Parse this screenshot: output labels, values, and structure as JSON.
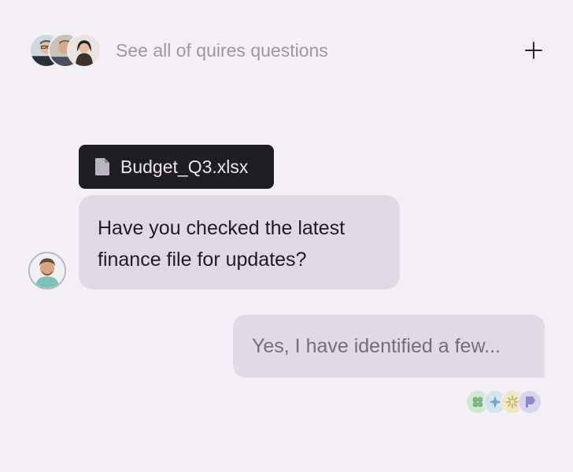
{
  "header": {
    "link_label": "See all of quires questions",
    "avatars": [
      "participant-1",
      "participant-2",
      "participant-3"
    ]
  },
  "attachment": {
    "file_name": "Budget_Q3.xlsx",
    "icon": "file-icon"
  },
  "messages": [
    {
      "direction": "incoming",
      "text": "Have you checked the latest finance file for updates?"
    },
    {
      "direction": "outgoing",
      "text": "Yes, I have identified a few..."
    }
  ],
  "reactors": [
    {
      "icon": "clover-icon",
      "color": "#cfe8cf",
      "fg": "#7fb27f"
    },
    {
      "icon": "sparkle-icon",
      "color": "#d4e4ee",
      "fg": "#7aa7c4"
    },
    {
      "icon": "burst-icon",
      "color": "#efe6c4",
      "fg": "#c8b46a"
    },
    {
      "icon": "flag-icon",
      "color": "#d8d3ef",
      "fg": "#9088c4"
    }
  ],
  "colors": {
    "background": "#f2f0f5",
    "chip_dark": "#1f1e22",
    "bubble": "#dddbe1"
  }
}
